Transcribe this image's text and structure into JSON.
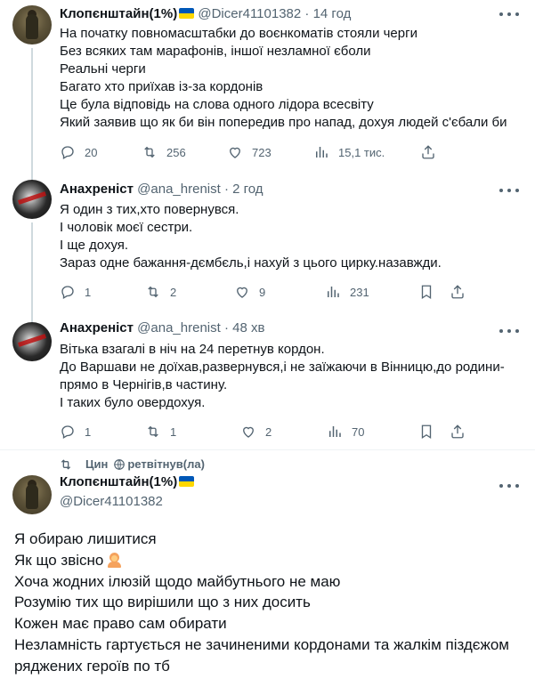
{
  "tweets": [
    {
      "name": "Клопєнштайн(1%)",
      "handle": "@Dicer41101382",
      "time": "· 14 год",
      "lines": [
        "На початку повномасштабки до воєнкоматів стояли черги",
        "Без всяких там марафонів, іншої незламної єболи",
        "Реальні черги",
        "Багато хто приїхав із-за кордонів",
        "Це була відповідь на слова одного лідора всесвіту",
        "Який заявив що як би він попередив про напад, дохуя людей с'єбали би"
      ],
      "replies": "20",
      "retweets": "256",
      "likes": "723",
      "views": "15,1 тис."
    },
    {
      "name": "Анахреніст",
      "handle": "@ana_hrenist",
      "time": "· 2 год",
      "lines": [
        "Я один з тих,хто повернувся.",
        "І чоловік моєї сестри.",
        "І ще дохуя.",
        "Зараз одне бажання-дємбєль,і нахуй з цього цирку.назавжди."
      ],
      "replies": "1",
      "retweets": "2",
      "likes": "9",
      "views": "231"
    },
    {
      "name": "Анахреніст",
      "handle": "@ana_hrenist",
      "time": "· 48 хв",
      "lines": [
        "Вітька взагалі в ніч на 24 перетнув кордон.",
        "До Варшави не доїхав,развернувся,і не заїжаючи в Вінницю,до родини-",
        "прямо в Чернігів,в частину.",
        "І таких було овердохуя."
      ],
      "replies": "1",
      "retweets": "1",
      "likes": "2",
      "views": "70"
    }
  ],
  "retweet_note": {
    "user": "Цин",
    "text": "ретвітнув(ла)"
  },
  "main_tweet": {
    "name": "Клопєнштайн(1%)",
    "handle": "@Dicer41101382",
    "lines": [
      "Я обираю лишитися",
      "Як що звісно",
      "Хоча жодних ілюзій щодо майбутнього не маю",
      "Розумію тих що вирішили що з них досить",
      "Кожен має право сам обирати",
      "Незламність гартується не зачиненими кордонами та жалкім піздєжом",
      "ряджених героїв по тб"
    ]
  },
  "icons": {
    "reply": "reply-icon",
    "retweet": "retweet-icon",
    "like": "heart-icon",
    "views": "views-icon",
    "bookmark": "bookmark-icon",
    "share": "share-icon",
    "more": "more-icon",
    "flag": "ukraine-flag-icon",
    "emoji": "person-shrugging-emoji"
  },
  "colors": {
    "text": "#0f1419",
    "secondary": "#536471",
    "thread_line": "#cfd9de",
    "flag_blue": "#0057b7",
    "flag_yellow": "#ffd700"
  }
}
